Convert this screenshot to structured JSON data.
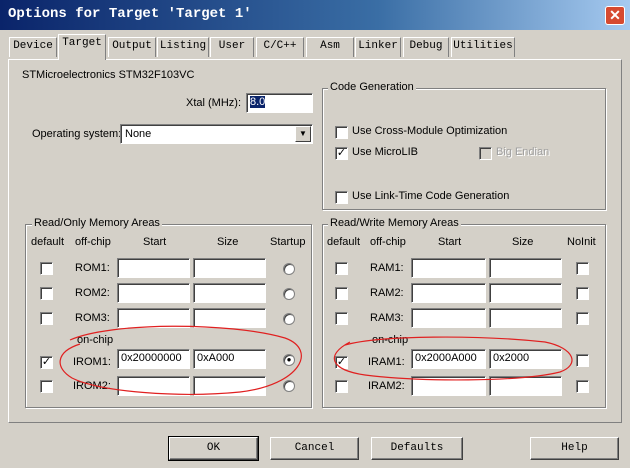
{
  "window": {
    "title": "Options for Target 'Target 1'",
    "close_symbol": "✕"
  },
  "tabs": [
    "Device",
    "Target",
    "Output",
    "Listing",
    "User",
    "C/C++",
    "Asm",
    "Linker",
    "Debug",
    "Utilities"
  ],
  "device_name": "STMicroelectronics STM32F103VC",
  "xtal": {
    "label": "Xtal (MHz):",
    "value": "8.0"
  },
  "os": {
    "label": "Operating system:",
    "value": "None"
  },
  "code_gen": {
    "title": "Code Generation",
    "cross_module": "Use Cross-Module Optimization",
    "microlib": "Use MicroLIB",
    "big_endian": "Big Endian",
    "ltcg": "Use Link-Time Code Generation",
    "check_mark": "✓"
  },
  "rom": {
    "title": "Read/Only Memory Areas",
    "headers": {
      "default": "default",
      "offchip": "off-chip",
      "start": "Start",
      "size": "Size",
      "startup": "Startup"
    },
    "onchip": "on-chip",
    "rows": [
      {
        "label": "ROM1:",
        "start": "",
        "size": ""
      },
      {
        "label": "ROM2:",
        "start": "",
        "size": ""
      },
      {
        "label": "ROM3:",
        "start": "",
        "size": ""
      },
      {
        "label": "IROM1:",
        "start": "0x20000000",
        "size": "0xA000"
      },
      {
        "label": "IROM2:",
        "start": "",
        "size": ""
      }
    ]
  },
  "ram": {
    "title": "Read/Write Memory Areas",
    "headers": {
      "default": "default",
      "offchip": "off-chip",
      "start": "Start",
      "size": "Size",
      "noinit": "NoInit"
    },
    "onchip": "on-chip",
    "rows": [
      {
        "label": "RAM1:",
        "start": "",
        "size": ""
      },
      {
        "label": "RAM2:",
        "start": "",
        "size": ""
      },
      {
        "label": "RAM3:",
        "start": "",
        "size": ""
      },
      {
        "label": "IRAM1:",
        "start": "0x2000A000",
        "size": "0x2000"
      },
      {
        "label": "IRAM2:",
        "start": "",
        "size": ""
      }
    ]
  },
  "buttons": {
    "ok": "OK",
    "cancel": "Cancel",
    "defaults": "Defaults",
    "help": "Help"
  },
  "colors": {
    "title_bar": "#0a246a",
    "annotation": "#e02020",
    "dialog": "#d4d0c8"
  }
}
